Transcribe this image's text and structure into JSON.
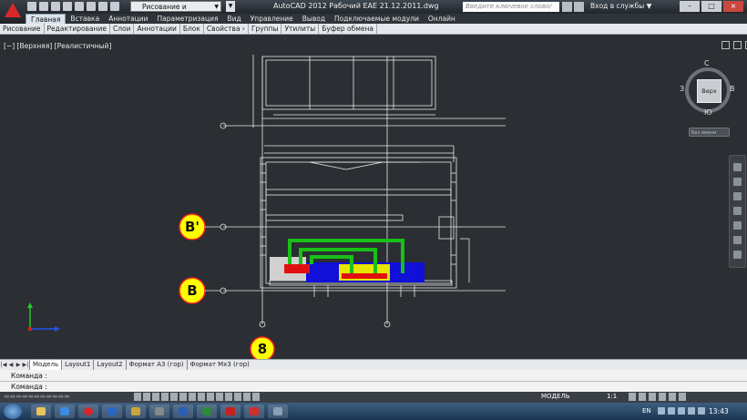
{
  "app": {
    "title": "AutoCAD 2012    Рабочий ЕАЕ 21.12.2011.dwg",
    "workspace": "Рисование и аннотации",
    "search_placeholder": "Введите ключевое слово/фразу",
    "login": "Вход в службы",
    "window_buttons": [
      "–",
      "□",
      "×"
    ]
  },
  "ribbon": {
    "tabs": [
      "Главная",
      "Вставка",
      "Аннотации",
      "Параметризация",
      "Вид",
      "Управление",
      "Вывод",
      "Подключаемые модули",
      "Онлайн"
    ],
    "panels": [
      "Рисование",
      "Редактирование",
      "Слои",
      "Аннотации",
      "Блок",
      "Свойства",
      "Группы",
      "Утилиты",
      "Буфер обмена"
    ]
  },
  "viewport": {
    "label": "[−] [Верхняя] [Реалистичный]",
    "viewcube": {
      "face": "Верх",
      "north": "С",
      "south": "Ю",
      "west": "З",
      "east": "В",
      "wcs": "Без имени"
    }
  },
  "drawing": {
    "axis_labels": [
      "В'",
      "В",
      "8"
    ],
    "colors": {
      "bubble_fill": "#ffff00",
      "bubble_stroke": "#ff2020",
      "duct_green": "#18c018",
      "equip_blue": "#1010d8",
      "equip_yellow": "#e6e600",
      "equip_red": "#e01010",
      "lines": "#ffffff"
    }
  },
  "layouts": {
    "tabs": [
      "Модель",
      "Layout1",
      "Layout2",
      "Формат А3 (гор)",
      "Формат Мх3 (гор)"
    ]
  },
  "command": {
    "line1": "Команда :",
    "line2": "Команда :"
  },
  "status": {
    "model": "МОДЕЛЬ",
    "scale": "1:1"
  },
  "taskbar": {
    "lang": "EN",
    "time": "13:43"
  }
}
